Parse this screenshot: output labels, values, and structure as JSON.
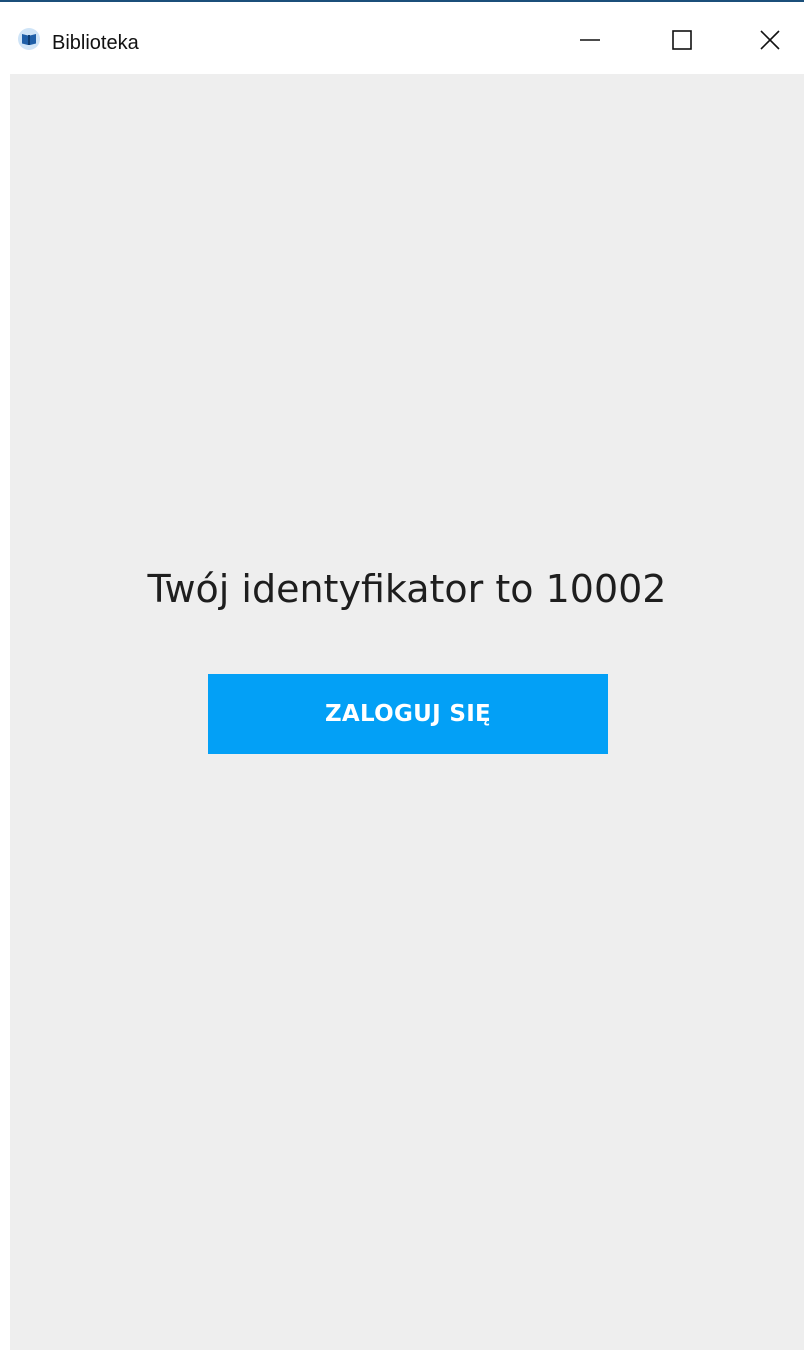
{
  "window": {
    "title": "Biblioteka",
    "icon": "book-icon",
    "controls": {
      "minimize": "minimize-icon",
      "maximize": "maximize-icon",
      "close": "close-icon"
    }
  },
  "main": {
    "message": "Twój identyfikator to 10002",
    "login_button_label": "ZALOGUJ SIĘ"
  },
  "colors": {
    "accent": "#03a0f6",
    "background": "#eeeeee",
    "titlebar": "#ffffff",
    "text": "#1e1e1e",
    "window_border": "#1b4f7a"
  }
}
